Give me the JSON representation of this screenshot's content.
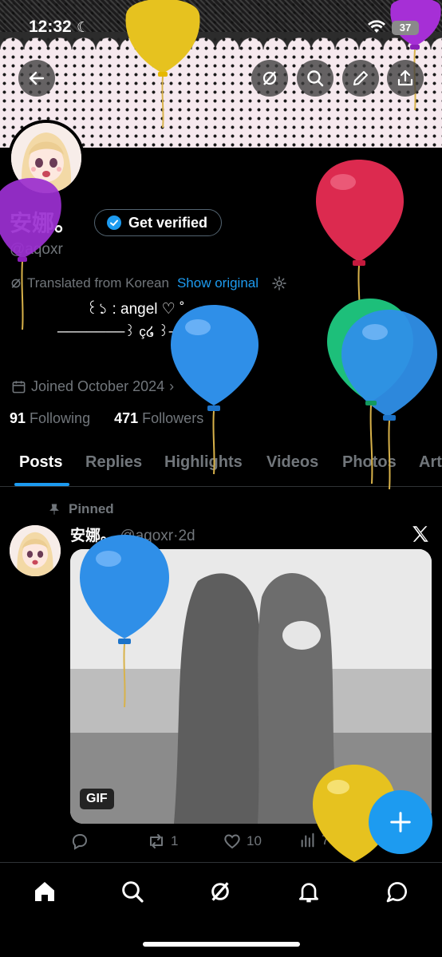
{
  "status_bar": {
    "time": "12:32",
    "battery": "37"
  },
  "profile": {
    "name": "安娜。",
    "handle": "@aqoxr",
    "get_verified": "Get verified",
    "translated_from": "Translated from Korean",
    "show_original": "Show original",
    "bio_line1": "꒰১ : angel ♡ ˚ ͙",
    "bio_line2": "───────꒱ ç໒ ꒱────────",
    "joined": "Joined October 2024",
    "following_count": "91",
    "following_label": "Following",
    "followers_count": "471",
    "followers_label": "Followers"
  },
  "tabs": [
    "Posts",
    "Replies",
    "Highlights",
    "Videos",
    "Photos",
    "Art"
  ],
  "post": {
    "pinned": "Pinned",
    "name": "安娜。",
    "handle": "@aqoxr",
    "time": "2d",
    "gif_label": "GIF",
    "retweets": "1",
    "likes": "10",
    "views": "787"
  },
  "colors": {
    "accent": "#1d9bf0",
    "background": "#000000",
    "muted_text": "#71767b"
  },
  "icons": {
    "header": [
      "back-arrow-icon",
      "grok-icon",
      "search-icon",
      "edit-icon",
      "share-icon"
    ],
    "bottom_nav": [
      "home-icon",
      "search-icon",
      "grok-icon",
      "notifications-icon",
      "messages-icon"
    ]
  }
}
